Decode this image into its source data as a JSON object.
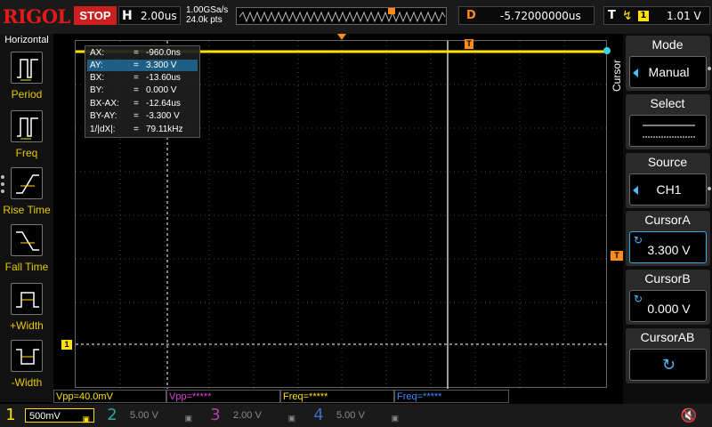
{
  "topbar": {
    "logo": "RIGOL",
    "run_state": "STOP",
    "timebase_key": "H",
    "timebase_value": "2.00us",
    "sample_rate": "1.00GSa/s",
    "memory_depth": "24.0k pts",
    "delay_key": "D",
    "delay_value": "-5.72000000us",
    "trigger_key": "T",
    "trigger_channel": "1",
    "trigger_level": "1.01 V",
    "icons": {
      "trigger_edge": "rising-edge-icon"
    }
  },
  "left_panel": {
    "title": "Horizontal",
    "items": [
      {
        "label": "Period",
        "icon": "period-icon"
      },
      {
        "label": "Freq",
        "icon": "freq-icon"
      },
      {
        "label": "Rise Time",
        "icon": "rise-time-icon"
      },
      {
        "label": "Fall Time",
        "icon": "fall-time-icon"
      },
      {
        "label": "+Width",
        "icon": "positive-width-icon"
      },
      {
        "label": "-Width",
        "icon": "negative-width-icon"
      }
    ]
  },
  "cursor_readout": {
    "rows": [
      {
        "key": "AX:",
        "value": "-960.0ns",
        "selected": false
      },
      {
        "key": "AY:",
        "value": "3.300 V",
        "selected": true
      },
      {
        "key": "BX:",
        "value": "-13.60us",
        "selected": false
      },
      {
        "key": "BY:",
        "value": "0.000 V",
        "selected": false
      },
      {
        "key": "BX-AX:",
        "value": "-12.64us",
        "selected": false
      },
      {
        "key": "BY-AY:",
        "value": "-3.300 V",
        "selected": false
      },
      {
        "key": "1/|dX|:",
        "value": "79.11kHz",
        "selected": false
      }
    ],
    "eq": "="
  },
  "markers": {
    "trigger_pos": "T",
    "channel1": "1",
    "trigger_level": "T"
  },
  "measurements": [
    {
      "text": "Vpp=40.0mV",
      "color": "#ffe200"
    },
    {
      "text": "Vpp=*****",
      "color": "#e040e0"
    },
    {
      "text": "Freq=*****",
      "color": "#ffe200"
    },
    {
      "text": "Freq=*****",
      "color": "#3a8cff"
    }
  ],
  "channels": [
    {
      "num": "1",
      "scale": "500mV",
      "color": "#ffe200",
      "active": true
    },
    {
      "num": "2",
      "scale": "5.00 V",
      "color": "#2aa4a4",
      "active": false
    },
    {
      "num": "3",
      "scale": "2.00 V",
      "color": "#b040b0",
      "active": false
    },
    {
      "num": "4",
      "scale": "5.00 V",
      "color": "#3a6cc0",
      "active": false
    }
  ],
  "bottom_icons": {
    "speaker": "speaker-muted-icon"
  },
  "right_menu": {
    "vertical_label": "Cursor",
    "mode": {
      "title": "Mode",
      "value": "Manual"
    },
    "select": {
      "title": "Select"
    },
    "source": {
      "title": "Source",
      "value": "CH1"
    },
    "cursor_a": {
      "title": "CursorA",
      "value": "3.300 V"
    },
    "cursor_b": {
      "title": "CursorB",
      "value": "0.000 V"
    },
    "cursor_ab": {
      "title": "CursorAB"
    }
  },
  "colors": {
    "ch1": "#ffe200",
    "accent": "#ff8c1a",
    "menu_active": "#3aa8e0",
    "stop": "#cc1f1f"
  }
}
